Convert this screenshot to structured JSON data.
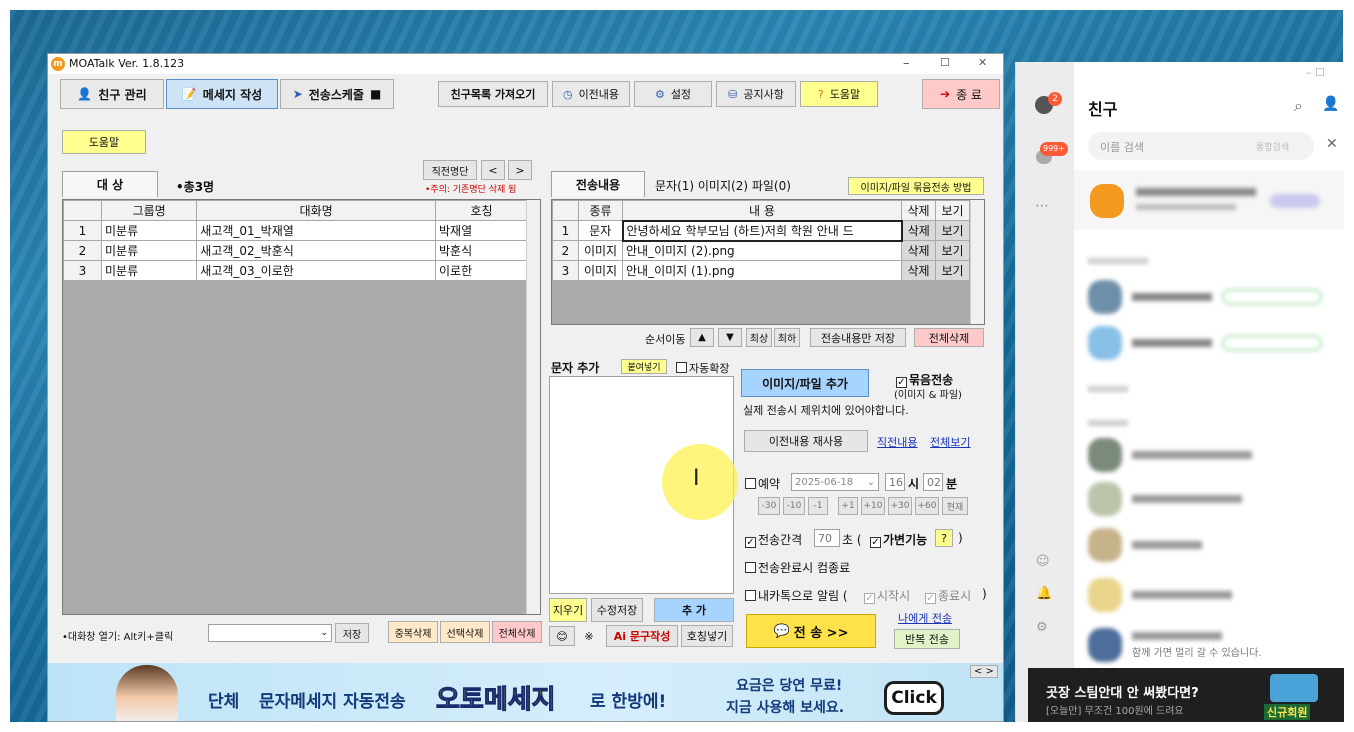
{
  "window": {
    "title": "MOATalk Ver. 1.8.123",
    "minimize": "–",
    "maximize": "☐",
    "close": "✕"
  },
  "toolbar": {
    "friend_manage": "친구 관리",
    "message_write": "메세지 작성",
    "send_schedule": "전송스케줄",
    "get_friends": "친구목록 가져오기",
    "history": "이전내용",
    "settings": "설정",
    "notice": "공지사항",
    "help": "도움말",
    "exit": "종 료"
  },
  "left": {
    "help_button": "도움말",
    "tab_target": "대 상",
    "total_count": "•총3명",
    "prev_list_button": "직전명단",
    "prev_arrow": "<",
    "next_arrow": ">",
    "warning": "•주의: 기존명단 삭제 됨",
    "columns": [
      "그룹명",
      "대화명",
      "호칭"
    ],
    "rows": [
      {
        "n": "1",
        "group": "미분류",
        "name": "새고객_01_박재열",
        "title": "박재열"
      },
      {
        "n": "2",
        "group": "미분류",
        "name": "새고객_02_박훈식",
        "title": "박훈식"
      },
      {
        "n": "3",
        "group": "미분류",
        "name": "새고객_03_이로한",
        "title": "이로한"
      }
    ],
    "open_chat_hint": "•대화창 열기: Alt키+클릭",
    "save_button": "저장",
    "dup_delete": "중복삭제",
    "sel_delete": "선택삭제",
    "all_delete": "전체삭제"
  },
  "right": {
    "tab_send_content": "전송내용",
    "tab_counts": "문자(1) 이미지(2) 파일(0)",
    "bundle_method": "이미지/파일 묶음전송 방법",
    "columns": [
      "종류",
      "내 용",
      "삭제",
      "보기"
    ],
    "rows": [
      {
        "n": "1",
        "kind": "문자",
        "content": "안녕하세요 학부모님 (하트)저희 학원 안내 드",
        "del": "삭제",
        "view": "보기"
      },
      {
        "n": "2",
        "kind": "이미지",
        "content": "안내_이미지 (2).png",
        "del": "삭제",
        "view": "보기"
      },
      {
        "n": "3",
        "kind": "이미지",
        "content": "안내_이미지 (1).png",
        "del": "삭제",
        "view": "보기"
      }
    ],
    "order_move": "순서이동",
    "up": "▲",
    "down": "▼",
    "top": "최상",
    "bottom": "최하",
    "save_only": "전송내용만 저장",
    "delete_all": "전체삭제",
    "text_add_label": "문자 추가",
    "paste_button": "붙여넣기",
    "auto_expand": "자동확장",
    "image_file_add": "이미지/파일 추가",
    "bundle_send": "묶음전송",
    "bundle_send_sub": "(이미지 & 파일)",
    "position_note": "실제 전송시 제위치에 있어야합니다.",
    "reuse_prev": "이전내용 재사용",
    "prev_content_link": "직전내용",
    "view_all_link": "전체보기",
    "reserve": "예약",
    "date": "2025-06-18",
    "hour": "16",
    "hour_unit": "시",
    "minute": "02",
    "minute_unit": "분",
    "offsets": [
      "-30",
      "-10",
      "-1",
      "+1",
      "+10",
      "+30",
      "+60",
      "현재"
    ],
    "interval_label": "전송간격",
    "interval_value": "70",
    "interval_unit": "초 (",
    "variable": "가변기능",
    "question": "?",
    "close_paren": ")",
    "shutdown": "전송완료시 컴종료",
    "notify_kakao": "내카톡으로 알림 (",
    "notify_start": "시작시",
    "notify_end": "종료시",
    "notify_close": ")",
    "clear": "지우기",
    "edit_save": "수정저장",
    "add": "추 가",
    "emoji": "😊",
    "symbol": "※",
    "ai_phrase": "Ai 문구작성",
    "title_insert": "호칭넣기",
    "send": "전 송 >>",
    "send_to_me": "나에게 전송",
    "repeat_send": "반복 전송"
  },
  "banner": {
    "prefix": "단체",
    "text": "문자메세지 자동전송",
    "brand": "오토메세지",
    "suffix": "로 한방에!",
    "free1": "요금은 당연 무료!",
    "free2": "지금 사용해 보세요.",
    "click": "Click",
    "nav": "< >"
  },
  "kakao": {
    "title": "친구",
    "search_placeholder": "이름 검색",
    "search_scope": "통합검색",
    "badge_friends": "2",
    "badge_chats": "999+",
    "ad_title": "곳장 스팀안대 안 써봤다면?",
    "ad_sub": "[오늘만] 무조건 100원에 드려요",
    "ad_badge": "신규회원",
    "last_status": "함께 가면 멀리 갈 수 있습니다."
  },
  "colors": {
    "accent_yellow": "#ffff8f",
    "pink": "#ffc9c9",
    "blue_btn": "#a7d3ff",
    "send_yellow": "#ffe24a"
  }
}
